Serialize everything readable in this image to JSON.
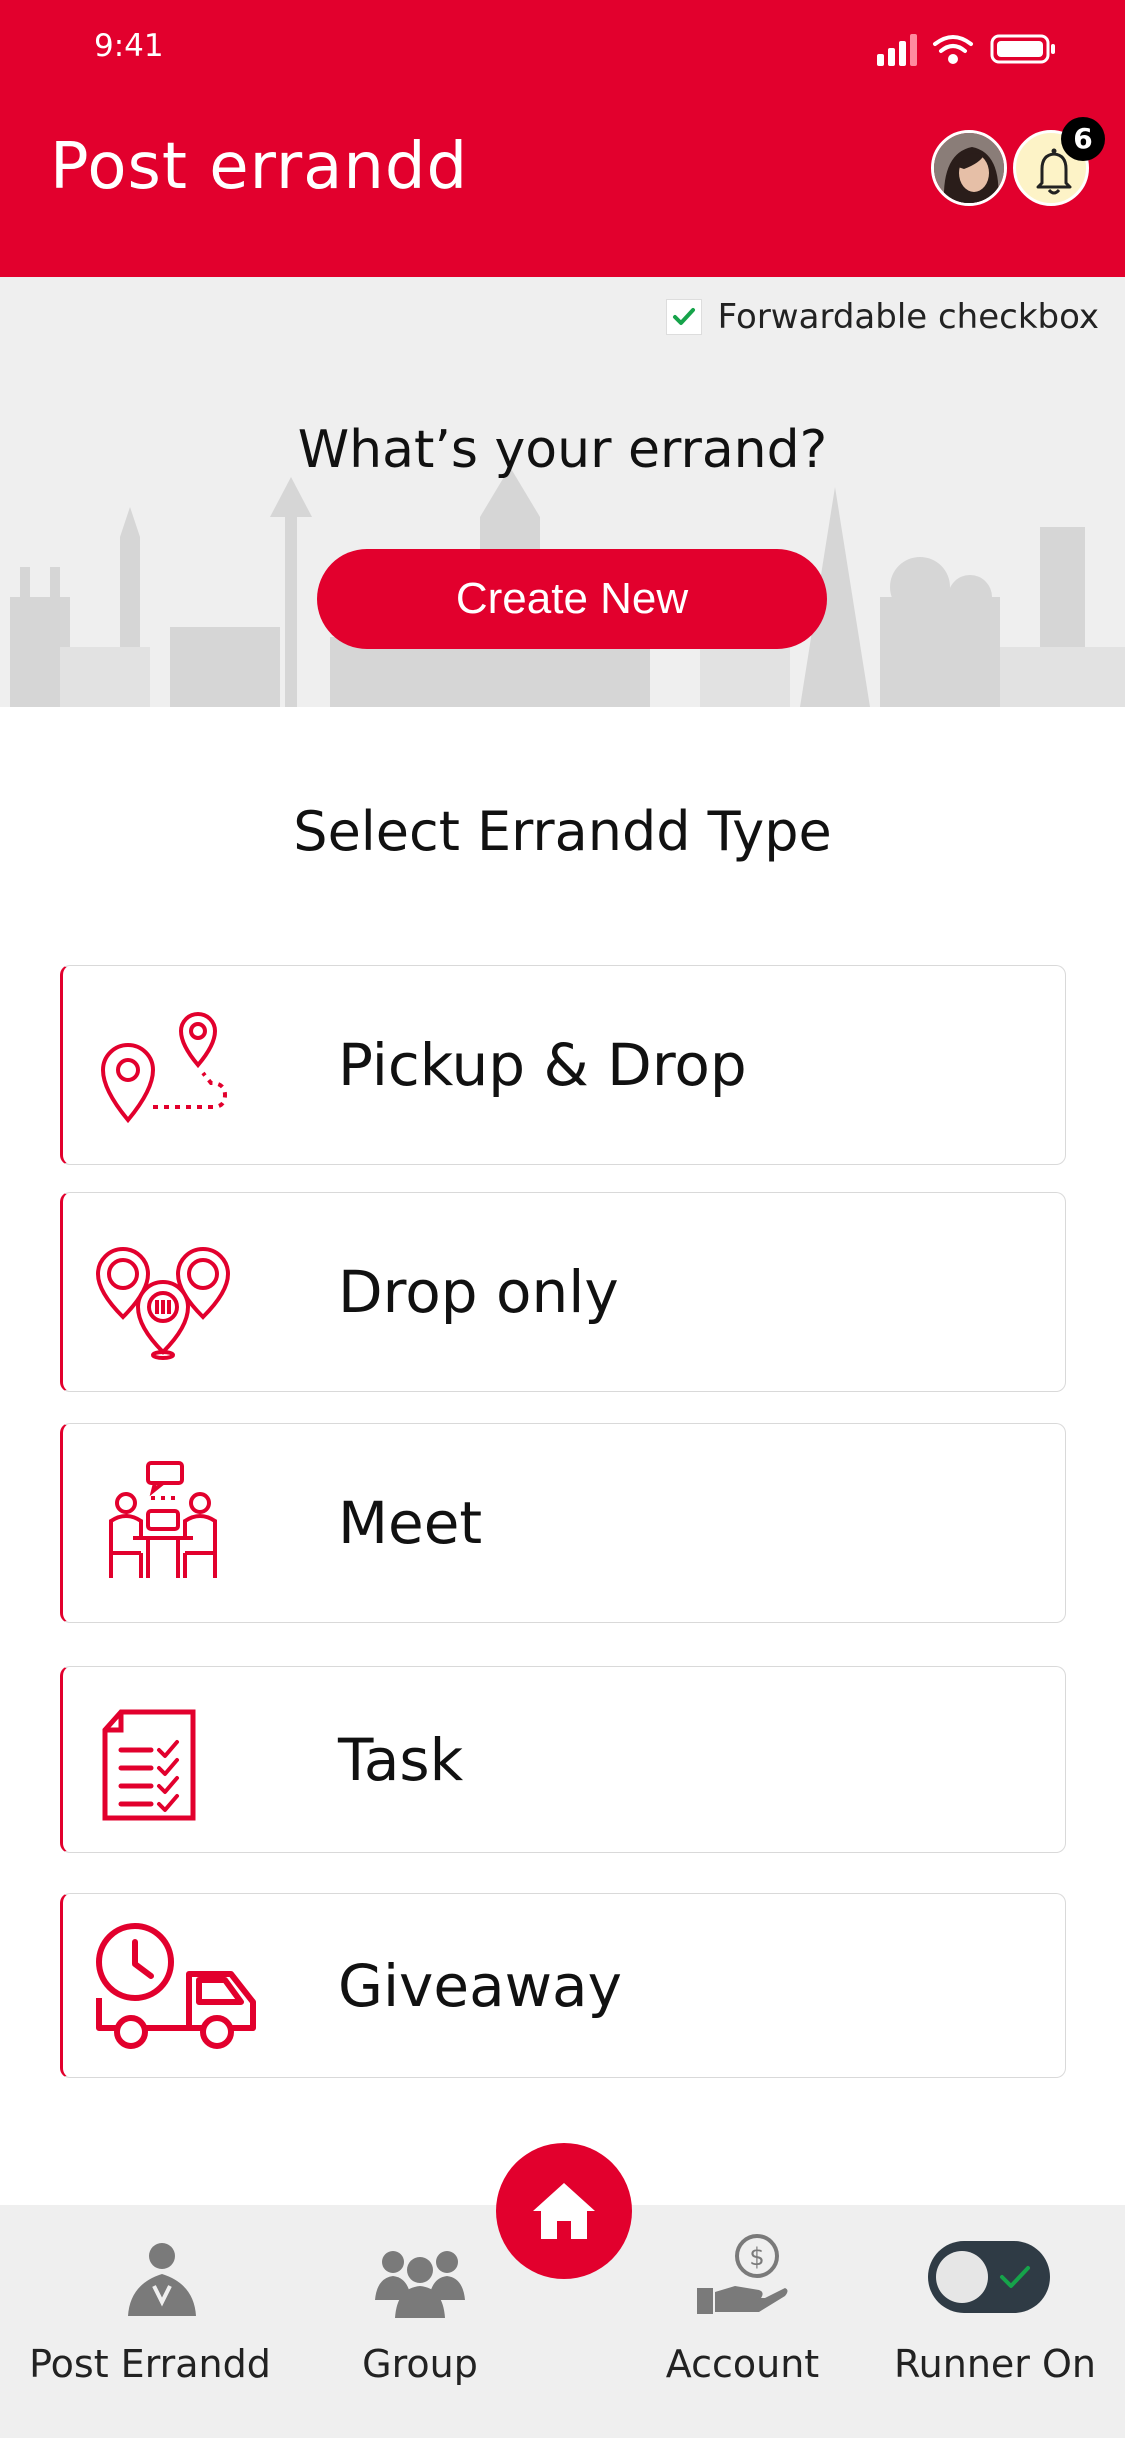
{
  "status_bar": {
    "time": "9:41"
  },
  "header": {
    "title": "Post errandd",
    "notification_count": "6"
  },
  "hero": {
    "forwardable_label": "Forwardable checkbox",
    "forwardable_checked": true,
    "question": "What’s your errand?",
    "create_button": "Create New"
  },
  "section": {
    "title": "Select Errandd Type",
    "items": [
      {
        "label": "Pickup & Drop",
        "icon": "pickup-drop-icon"
      },
      {
        "label": "Drop only",
        "icon": "drop-only-icon"
      },
      {
        "label": "Meet",
        "icon": "meet-icon"
      },
      {
        "label": "Task",
        "icon": "task-icon"
      },
      {
        "label": "Giveaway",
        "icon": "giveaway-icon"
      }
    ]
  },
  "bottom_nav": {
    "items": [
      {
        "label": "Post Errandd",
        "icon": "post-errandd-icon"
      },
      {
        "label": "Group",
        "icon": "group-icon"
      },
      {
        "label": "Account",
        "icon": "account-icon"
      },
      {
        "label": "Runner On",
        "icon": "runner-toggle-icon"
      }
    ],
    "home_icon": "home-icon",
    "runner_on": true
  },
  "colors": {
    "brand": "#e2002d",
    "check_green": "#16a34a",
    "toggle_track": "#2f3b45"
  }
}
